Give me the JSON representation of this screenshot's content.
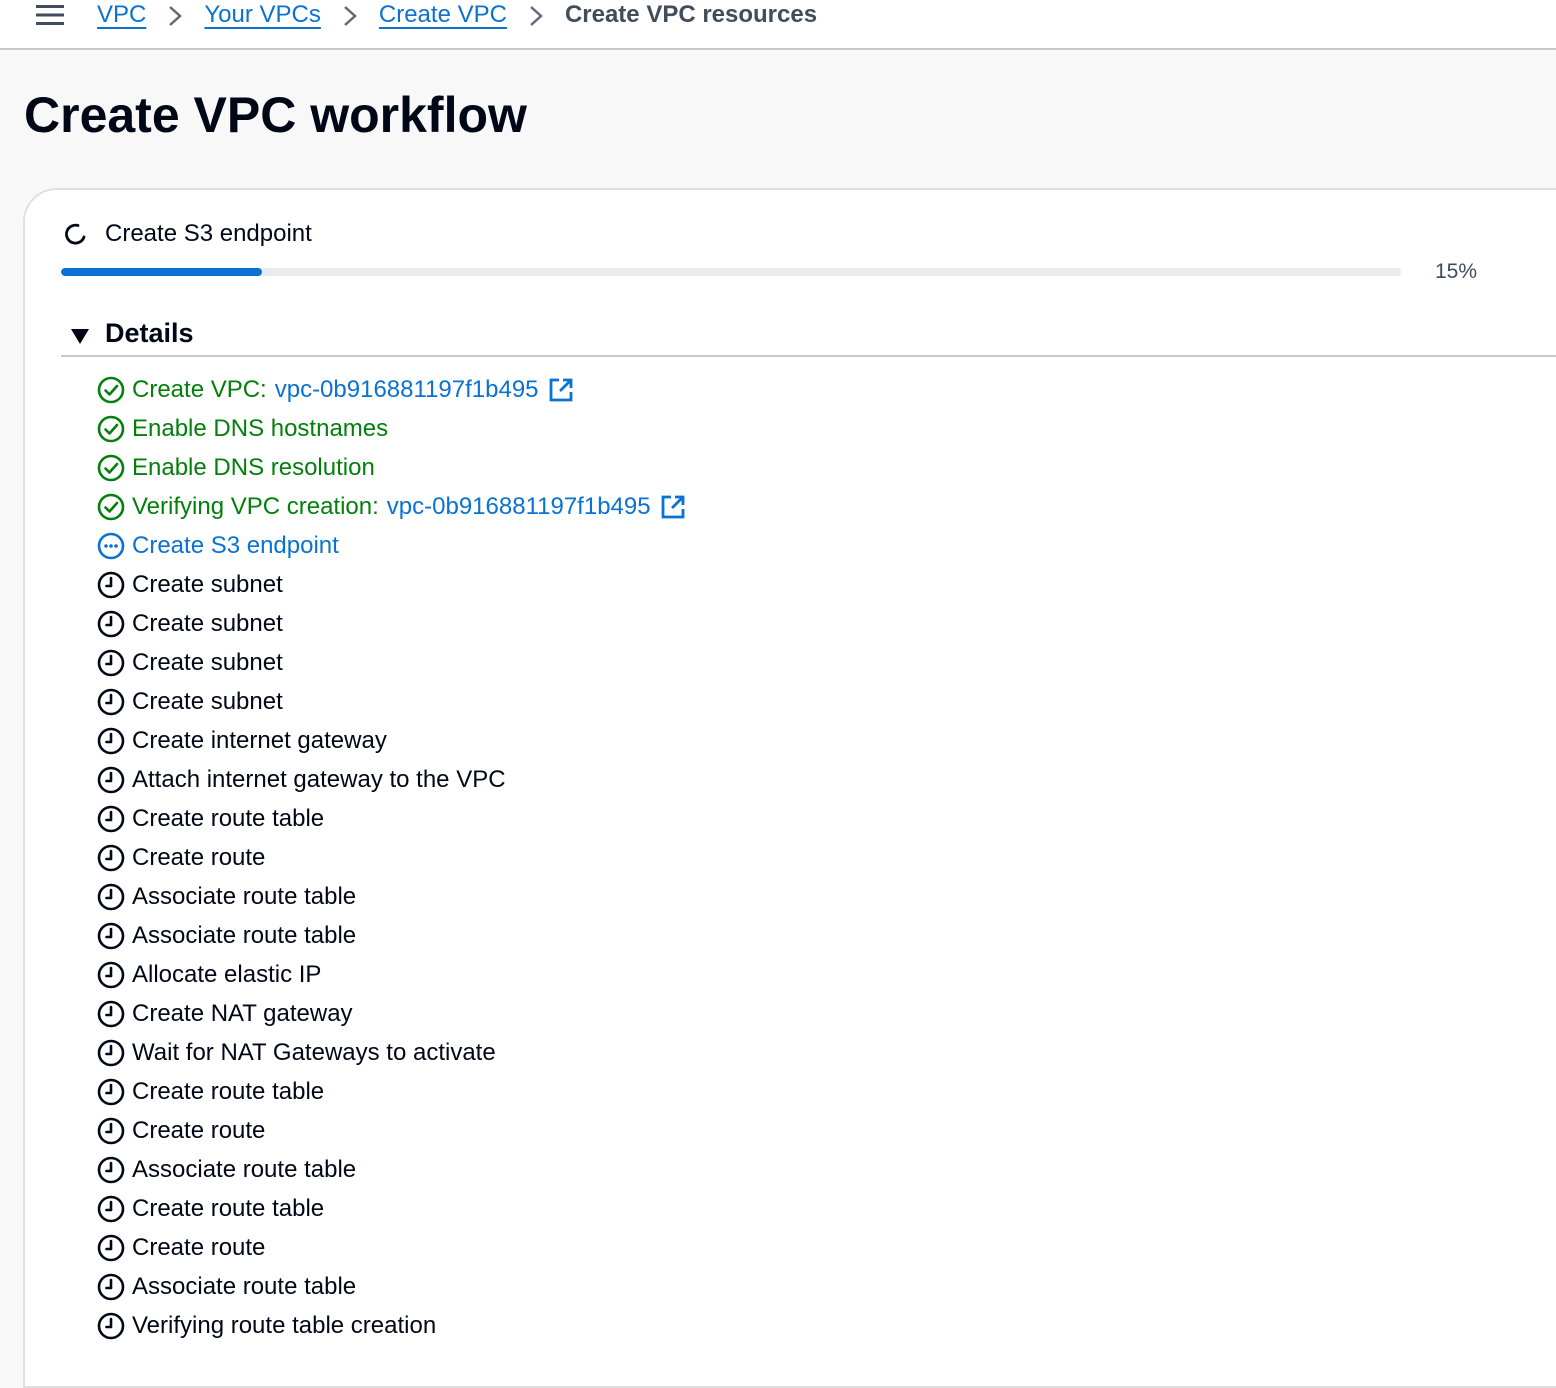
{
  "breadcrumb": {
    "items": [
      {
        "label": "VPC",
        "link": true
      },
      {
        "label": "Your VPCs",
        "link": true
      },
      {
        "label": "Create VPC",
        "link": true
      },
      {
        "label": "Create VPC resources",
        "link": false
      }
    ]
  },
  "page": {
    "title": "Create VPC workflow"
  },
  "status": {
    "current_step": "Create S3 endpoint",
    "progress_percent": 15,
    "progress_label": "15%"
  },
  "details": {
    "heading": "Details",
    "expanded": true,
    "steps": [
      {
        "label": "Create VPC:",
        "status": "done",
        "link": "vpc-0b916881197f1b495",
        "external": true
      },
      {
        "label": "Enable DNS hostnames",
        "status": "done"
      },
      {
        "label": "Enable DNS resolution",
        "status": "done"
      },
      {
        "label": "Verifying VPC creation:",
        "status": "done",
        "link": "vpc-0b916881197f1b495",
        "external": true
      },
      {
        "label": "Create S3 endpoint",
        "status": "in-progress"
      },
      {
        "label": "Create subnet",
        "status": "pending"
      },
      {
        "label": "Create subnet",
        "status": "pending"
      },
      {
        "label": "Create subnet",
        "status": "pending"
      },
      {
        "label": "Create subnet",
        "status": "pending"
      },
      {
        "label": "Create internet gateway",
        "status": "pending"
      },
      {
        "label": "Attach internet gateway to the VPC",
        "status": "pending"
      },
      {
        "label": "Create route table",
        "status": "pending"
      },
      {
        "label": "Create route",
        "status": "pending"
      },
      {
        "label": "Associate route table",
        "status": "pending"
      },
      {
        "label": "Associate route table",
        "status": "pending"
      },
      {
        "label": "Allocate elastic IP",
        "status": "pending"
      },
      {
        "label": "Create NAT gateway",
        "status": "pending"
      },
      {
        "label": "Wait for NAT Gateways to activate",
        "status": "pending"
      },
      {
        "label": "Create route table",
        "status": "pending"
      },
      {
        "label": "Create route",
        "status": "pending"
      },
      {
        "label": "Associate route table",
        "status": "pending"
      },
      {
        "label": "Create route table",
        "status": "pending"
      },
      {
        "label": "Create route",
        "status": "pending"
      },
      {
        "label": "Associate route table",
        "status": "pending"
      },
      {
        "label": "Verifying route table creation",
        "status": "pending"
      }
    ]
  },
  "icons": {
    "menu": "hamburger-menu-icon",
    "separator": "chevron-right-icon",
    "spinner": "loading-spinner-icon",
    "caret": "caret-down-icon",
    "done": "check-circle-icon",
    "in-progress": "in-progress-ellipsis-icon",
    "pending": "clock-icon",
    "external": "external-link-icon"
  },
  "colors": {
    "link": "#0972d3",
    "success": "#037f0c",
    "text": "#000716",
    "progress_fill": "#0972d3",
    "progress_track": "#e9ebed",
    "page_background": "#f8f8f8"
  }
}
